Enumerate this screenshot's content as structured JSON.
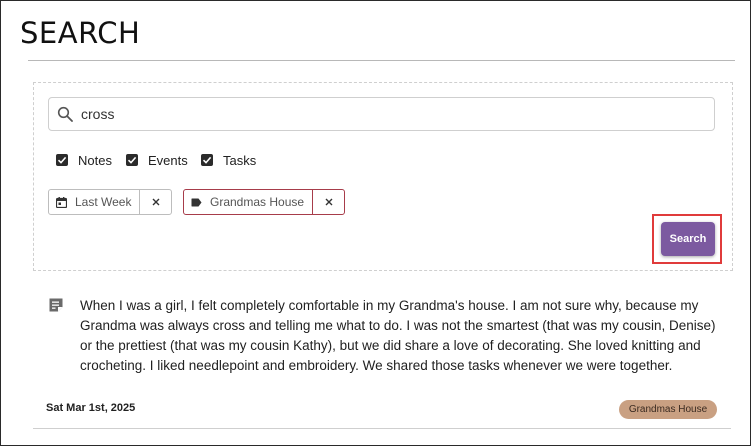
{
  "page": {
    "title": "SEARCH"
  },
  "search": {
    "value": "cross",
    "placeholder": ""
  },
  "filters": {
    "notes": {
      "label": "Notes",
      "checked": true
    },
    "events": {
      "label": "Events",
      "checked": true
    },
    "tasks": {
      "label": "Tasks",
      "checked": true
    }
  },
  "chips": [
    {
      "label": "Last Week",
      "icon": "calendar-icon"
    },
    {
      "label": "Grandmas House",
      "icon": "tag-icon"
    }
  ],
  "search_button": {
    "label": "Search",
    "color": "#7c5aa0"
  },
  "results": [
    {
      "icon": "note-icon",
      "text": "When I was a girl, I felt completely comfortable in my Grandma's house. I am not sure why, because my Grandma was always cross and telling me what to do. I was not the smartest (that was my cousin, Denise) or the prettiest (that was my cousin Kathy), but we did share a love of decorating. She loved knitting and crocheting. I liked needlepoint and embroidery. We shared those tasks whenever we were together.",
      "date": "Sat Mar 1st, 2025",
      "tag": "Grandmas House",
      "tag_color": "#c9a082"
    }
  ],
  "colors": {
    "highlight": "#e03b3b",
    "chip_border_active": "#a73c4a"
  }
}
